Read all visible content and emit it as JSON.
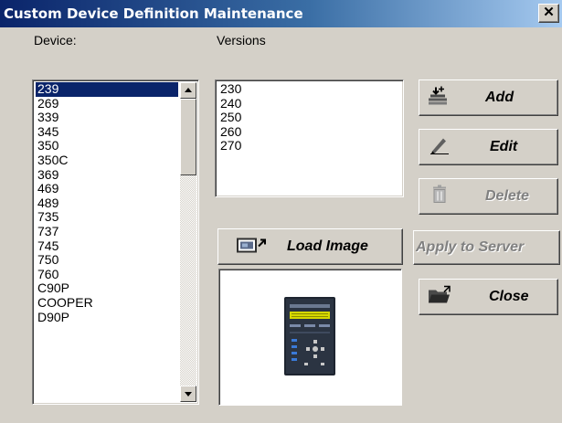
{
  "window": {
    "title": "Custom Device Definition Maintenance",
    "close_glyph": "✕"
  },
  "device": {
    "label": "Device:",
    "selected": "239",
    "items": [
      "239",
      "269",
      "339",
      "345",
      "350",
      "350C",
      "369",
      "469",
      "489",
      "735",
      "737",
      "745",
      "750",
      "760",
      "C90P",
      "COOPER",
      "D90P"
    ]
  },
  "versions": {
    "label": "Versions",
    "items": [
      "230",
      "240",
      "250",
      "260",
      "270"
    ]
  },
  "buttons": {
    "add": "Add",
    "edit": "Edit",
    "delete": "Delete",
    "load_image": "Load Image",
    "apply_to_server": "Apply to Server",
    "close": "Close"
  },
  "icons": {
    "add": "add-stack-icon",
    "edit": "pen-icon",
    "delete": "trash-icon",
    "load_image": "load-image-icon",
    "close": "folder-close-icon",
    "device_preview": "relay-device-image"
  },
  "colors": {
    "selection": "#0a246a",
    "title_start": "#0a246a",
    "title_end": "#a6caf0",
    "face": "#d4d0c8"
  }
}
